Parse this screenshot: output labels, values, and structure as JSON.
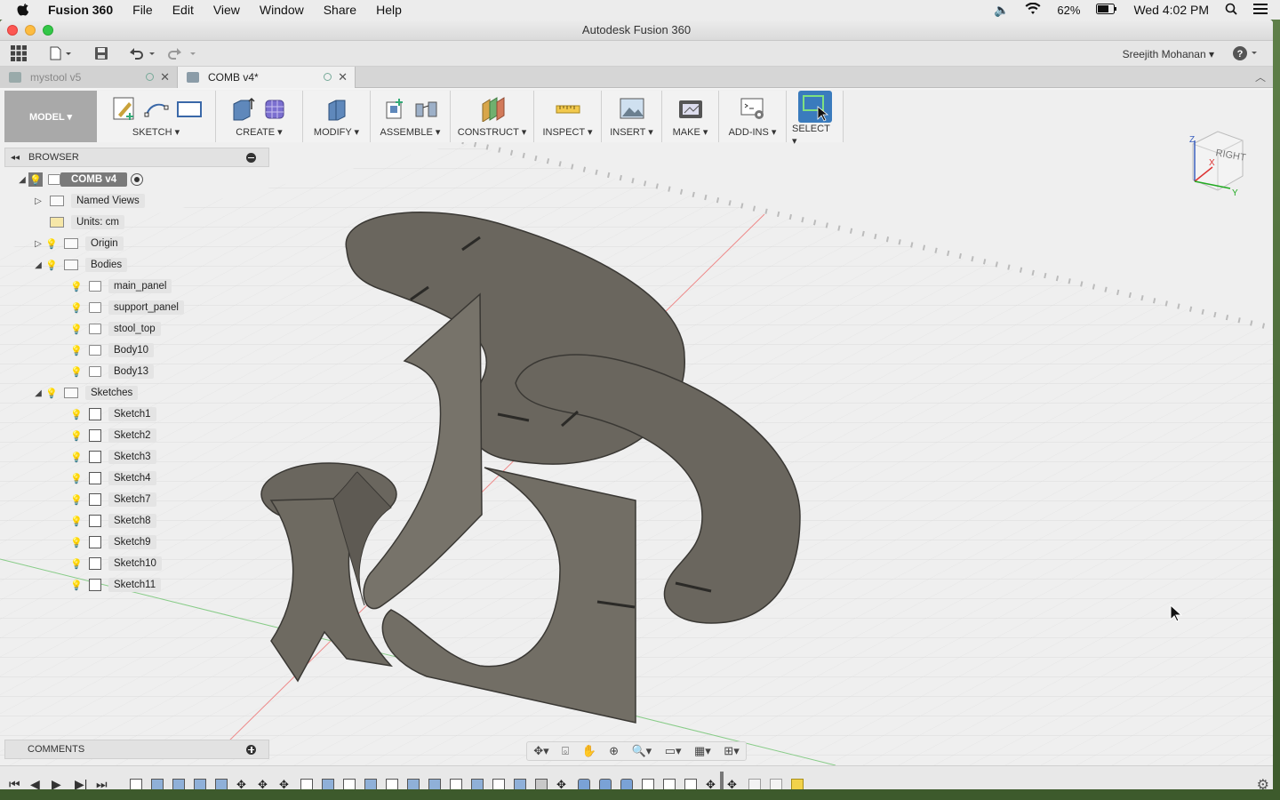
{
  "menubar": {
    "app_name": "Fusion 360",
    "items": [
      "File",
      "Edit",
      "View",
      "Window",
      "Share",
      "Help"
    ],
    "battery": "62%",
    "clock": "Wed 4:02 PM"
  },
  "window": {
    "title": "Autodesk Fusion 360"
  },
  "quickbar": {
    "user": "Sreejith Mohanan ▾"
  },
  "tabs": [
    {
      "label": "mystool v5"
    },
    {
      "label": "COMB v4*"
    }
  ],
  "toolbar": {
    "model_label": "MODEL ▾",
    "groups": [
      {
        "label": "SKETCH ▾"
      },
      {
        "label": "CREATE ▾"
      },
      {
        "label": "MODIFY ▾"
      },
      {
        "label": "ASSEMBLE ▾"
      },
      {
        "label": "CONSTRUCT ▾"
      },
      {
        "label": "INSPECT ▾"
      },
      {
        "label": "INSERT ▾"
      },
      {
        "label": "MAKE ▾"
      },
      {
        "label": "ADD-INS ▾"
      },
      {
        "label": "SELECT ▾"
      }
    ]
  },
  "browser": {
    "title": "BROWSER",
    "root": "COMB v4",
    "named_views": "Named Views",
    "units": "Units: cm",
    "origin": "Origin",
    "bodies": "Bodies",
    "body_items": [
      "main_panel",
      "support_panel",
      "stool_top",
      "Body10",
      "Body13"
    ],
    "sketches": "Sketches",
    "sketch_items": [
      "Sketch1",
      "Sketch2",
      "Sketch3",
      "Sketch4",
      "Sketch7",
      "Sketch8",
      "Sketch9",
      "Sketch10",
      "Sketch11"
    ]
  },
  "comments": {
    "title": "COMMENTS"
  },
  "viewcube": {
    "face": "RIGHT",
    "axis_z": "Z",
    "axis_x": "X",
    "axis_y": "Y"
  },
  "colors": {
    "model_fill": "#6a665e",
    "model_edge": "#3a3834",
    "grid": "#d8d8d8",
    "select_accent": "#3a7bbd"
  }
}
